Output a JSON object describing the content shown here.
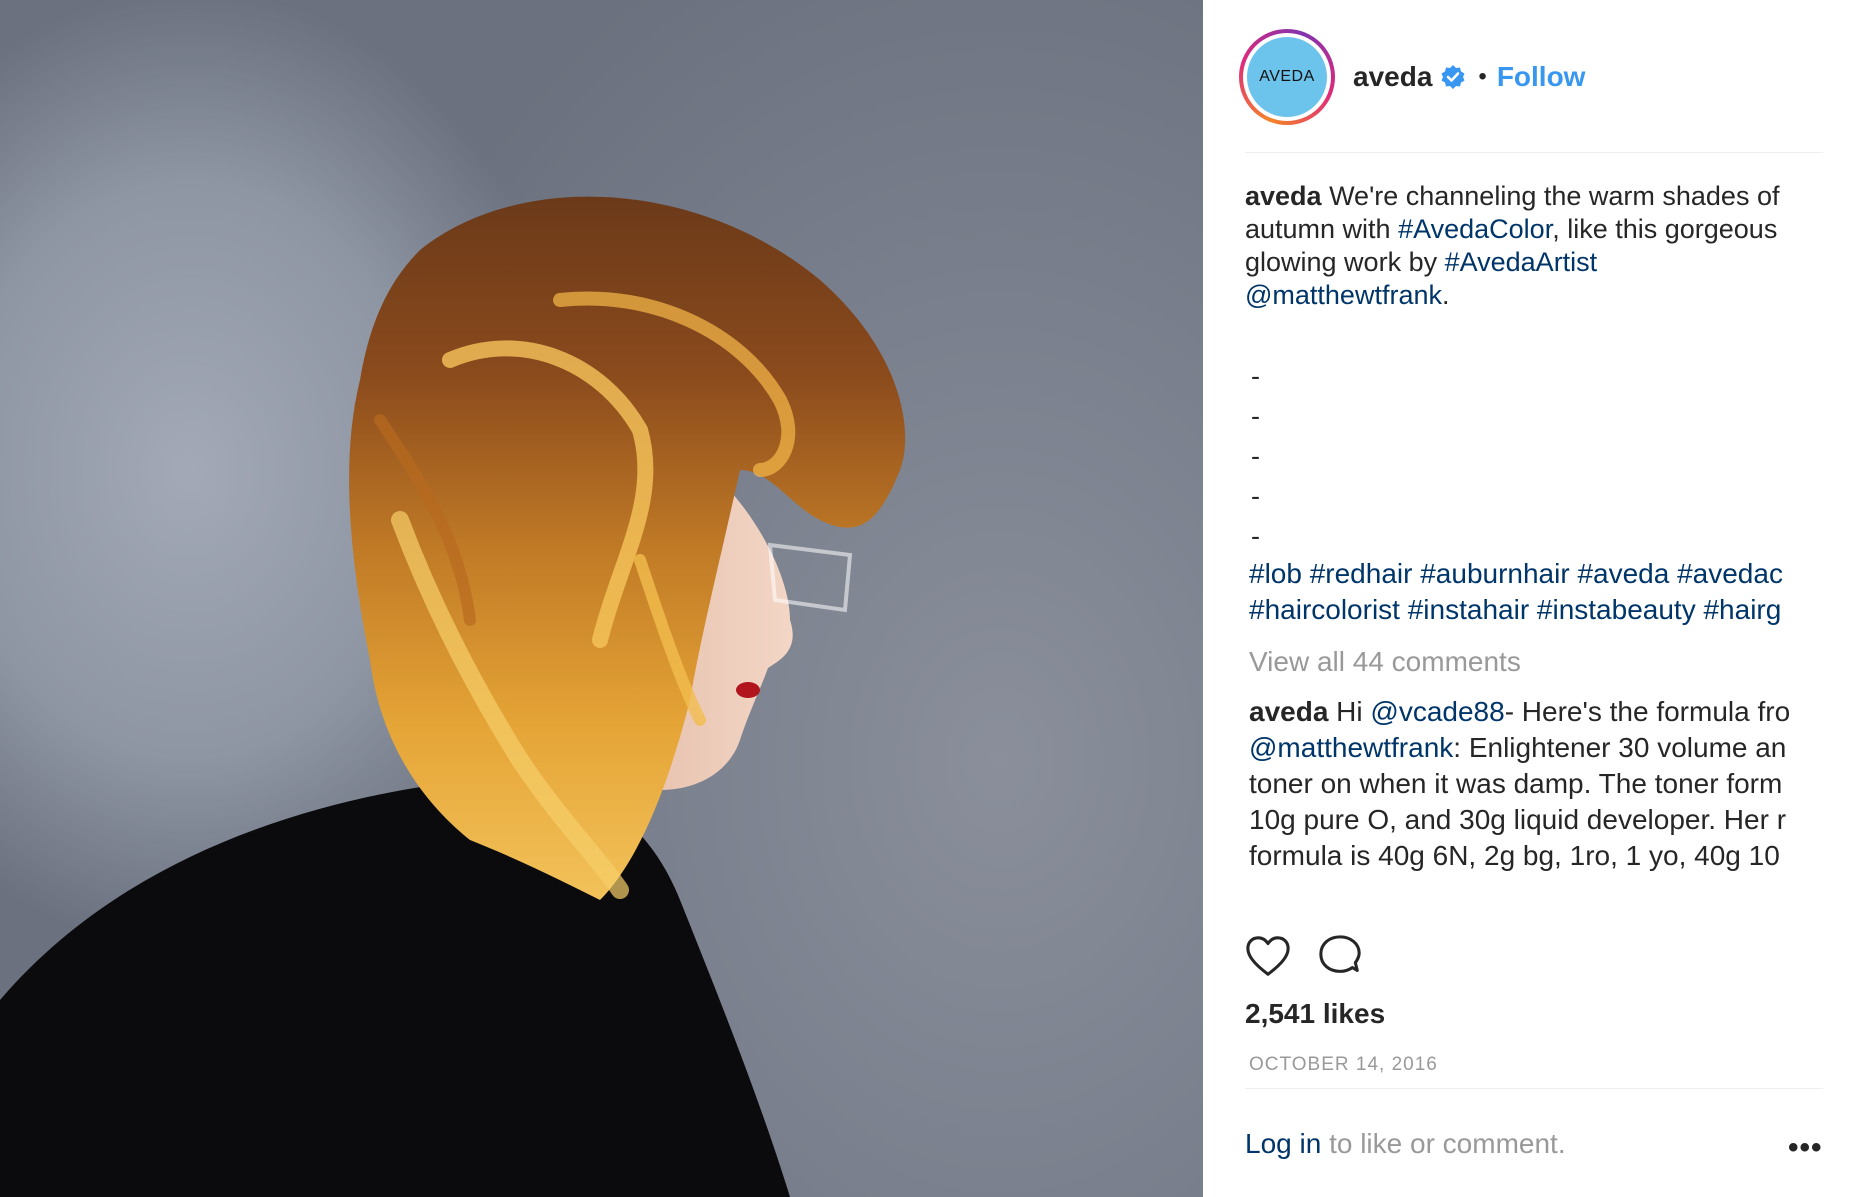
{
  "post": {
    "image_alt": "Woman with auburn-to-copper bob hairstyle in profile against a grey wall",
    "header": {
      "avatar_text": "AVEDA",
      "username": "aveda",
      "separator": "•",
      "follow_label": "Follow"
    },
    "caption": {
      "username": "aveda",
      "text_1": " We're channeling the warm shades of autumn with ",
      "hashtag_1": "#AvedaColor",
      "text_2": ", like this gorgeous glowing work by ",
      "hashtag_2": "#AvedaArtist",
      "text_3": " ",
      "mention_1": "@matthewtfrank",
      "text_4": ".",
      "dashes": [
        "-",
        "-",
        "-",
        "-",
        "-"
      ],
      "hashtags_line_1": "#lob #redhair #auburnhair #aveda #avedac",
      "hashtags_line_2": "#haircolorist #instahair #instabeauty #hairg"
    },
    "view_all_comments": "View all 44 comments",
    "comment": {
      "username": "aveda",
      "t1": " Hi ",
      "mention_1": "@vcade88",
      "t2": "- Here's the formula fro",
      "mention_2": "@matthewtfrank",
      "t3": ": Enlightener 30 volume an",
      "line_3": "toner on when it was damp. The toner form",
      "line_4": "10g pure O, and 30g liquid developer. Her r",
      "line_5": "formula is 40g 6N, 2g bg, 1ro, 1 yo, 40g 10"
    },
    "actions": {
      "like_icon": "heart-icon",
      "comment_icon": "comment-bubble-icon"
    },
    "likes_count": "2,541",
    "likes_label": "likes",
    "date": "OCTOBER 14, 2016",
    "footer": {
      "login_label": "Log in",
      "rest_label": " to like or comment.",
      "more_label": "•••"
    },
    "colors": {
      "link": "#003569",
      "follow": "#3897f0",
      "verified": "#3897f0",
      "muted": "#999999",
      "avatar_bg": "#6cc3ec"
    }
  }
}
